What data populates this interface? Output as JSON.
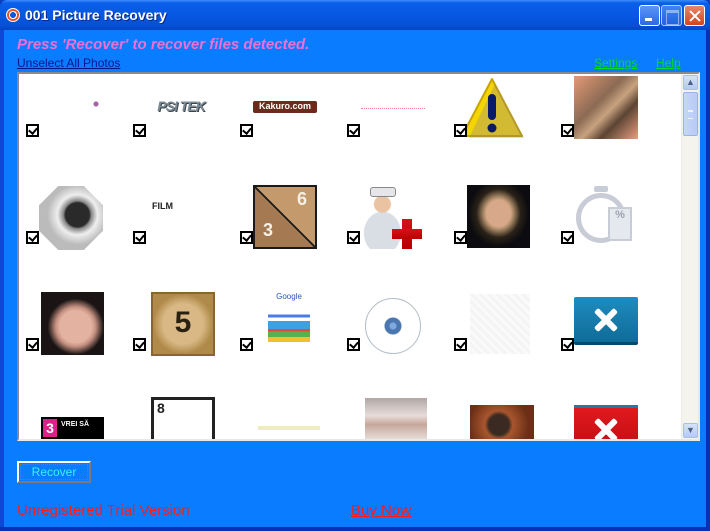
{
  "window": {
    "title": "001 Picture Recovery",
    "controls": {
      "minimize": "minimize",
      "maximize": "maximize",
      "close": "close"
    }
  },
  "header": {
    "headline": "Press 'Recover' to recover files detected.",
    "unselect_all_label": "Unselect All Photos",
    "settings_label": "Settings",
    "help_label": "Help"
  },
  "gallery": {
    "items": [
      {
        "name": "tiny-purple-dot-image",
        "checked": true
      },
      {
        "name": "psitek-logo-image",
        "checked": true,
        "text": "PSI TEK"
      },
      {
        "name": "kakuro-logo-image",
        "checked": true,
        "text": "Kakuro.com"
      },
      {
        "name": "dotted-line-image",
        "checked": true
      },
      {
        "name": "warning-triangle-image",
        "checked": true,
        "text": "!"
      },
      {
        "name": "lizard-photo",
        "checked": true
      },
      {
        "name": "soccer-ball-image",
        "checked": true
      },
      {
        "name": "film-text-image",
        "checked": true,
        "text": "FILM"
      },
      {
        "name": "kakuro-tile-image",
        "checked": true,
        "text_a": "3",
        "text_b": "6"
      },
      {
        "name": "doctor-cross-icon-image",
        "checked": true
      },
      {
        "name": "woman-portrait-photo",
        "checked": true
      },
      {
        "name": "stopwatch-percent-icon-image",
        "checked": true,
        "text": "%"
      },
      {
        "name": "woman-selfie-photo",
        "checked": true
      },
      {
        "name": "number-five-tile-image",
        "checked": true,
        "text": "5"
      },
      {
        "name": "google-collage-image",
        "checked": true,
        "text": "Google"
      },
      {
        "name": "flower-outline-image",
        "checked": true
      },
      {
        "name": "faint-texture-image",
        "checked": true
      },
      {
        "name": "blue-x-button-image",
        "checked": true
      },
      {
        "name": "vrei-sa-banner-image",
        "checked": true,
        "text": "VREI SĂ"
      },
      {
        "name": "sudoku-eight-tile-image",
        "checked": true,
        "text": "8"
      },
      {
        "name": "yellow-bar-image",
        "checked": true
      },
      {
        "name": "chest-photo",
        "checked": true
      },
      {
        "name": "orangutan-photo",
        "checked": true
      },
      {
        "name": "red-x-button-image",
        "checked": true
      }
    ],
    "scroll_position": 0
  },
  "footer": {
    "recover_label": "Recover",
    "trial_text": "Unregistered Trial Version",
    "buy_now_label": "Buy Now"
  },
  "colors": {
    "background": "#0a7cff",
    "headline": "#ee6fd6",
    "links_green": "#00dd22",
    "trial_red": "#ff1a1a",
    "recover_text": "#38f0ff"
  }
}
